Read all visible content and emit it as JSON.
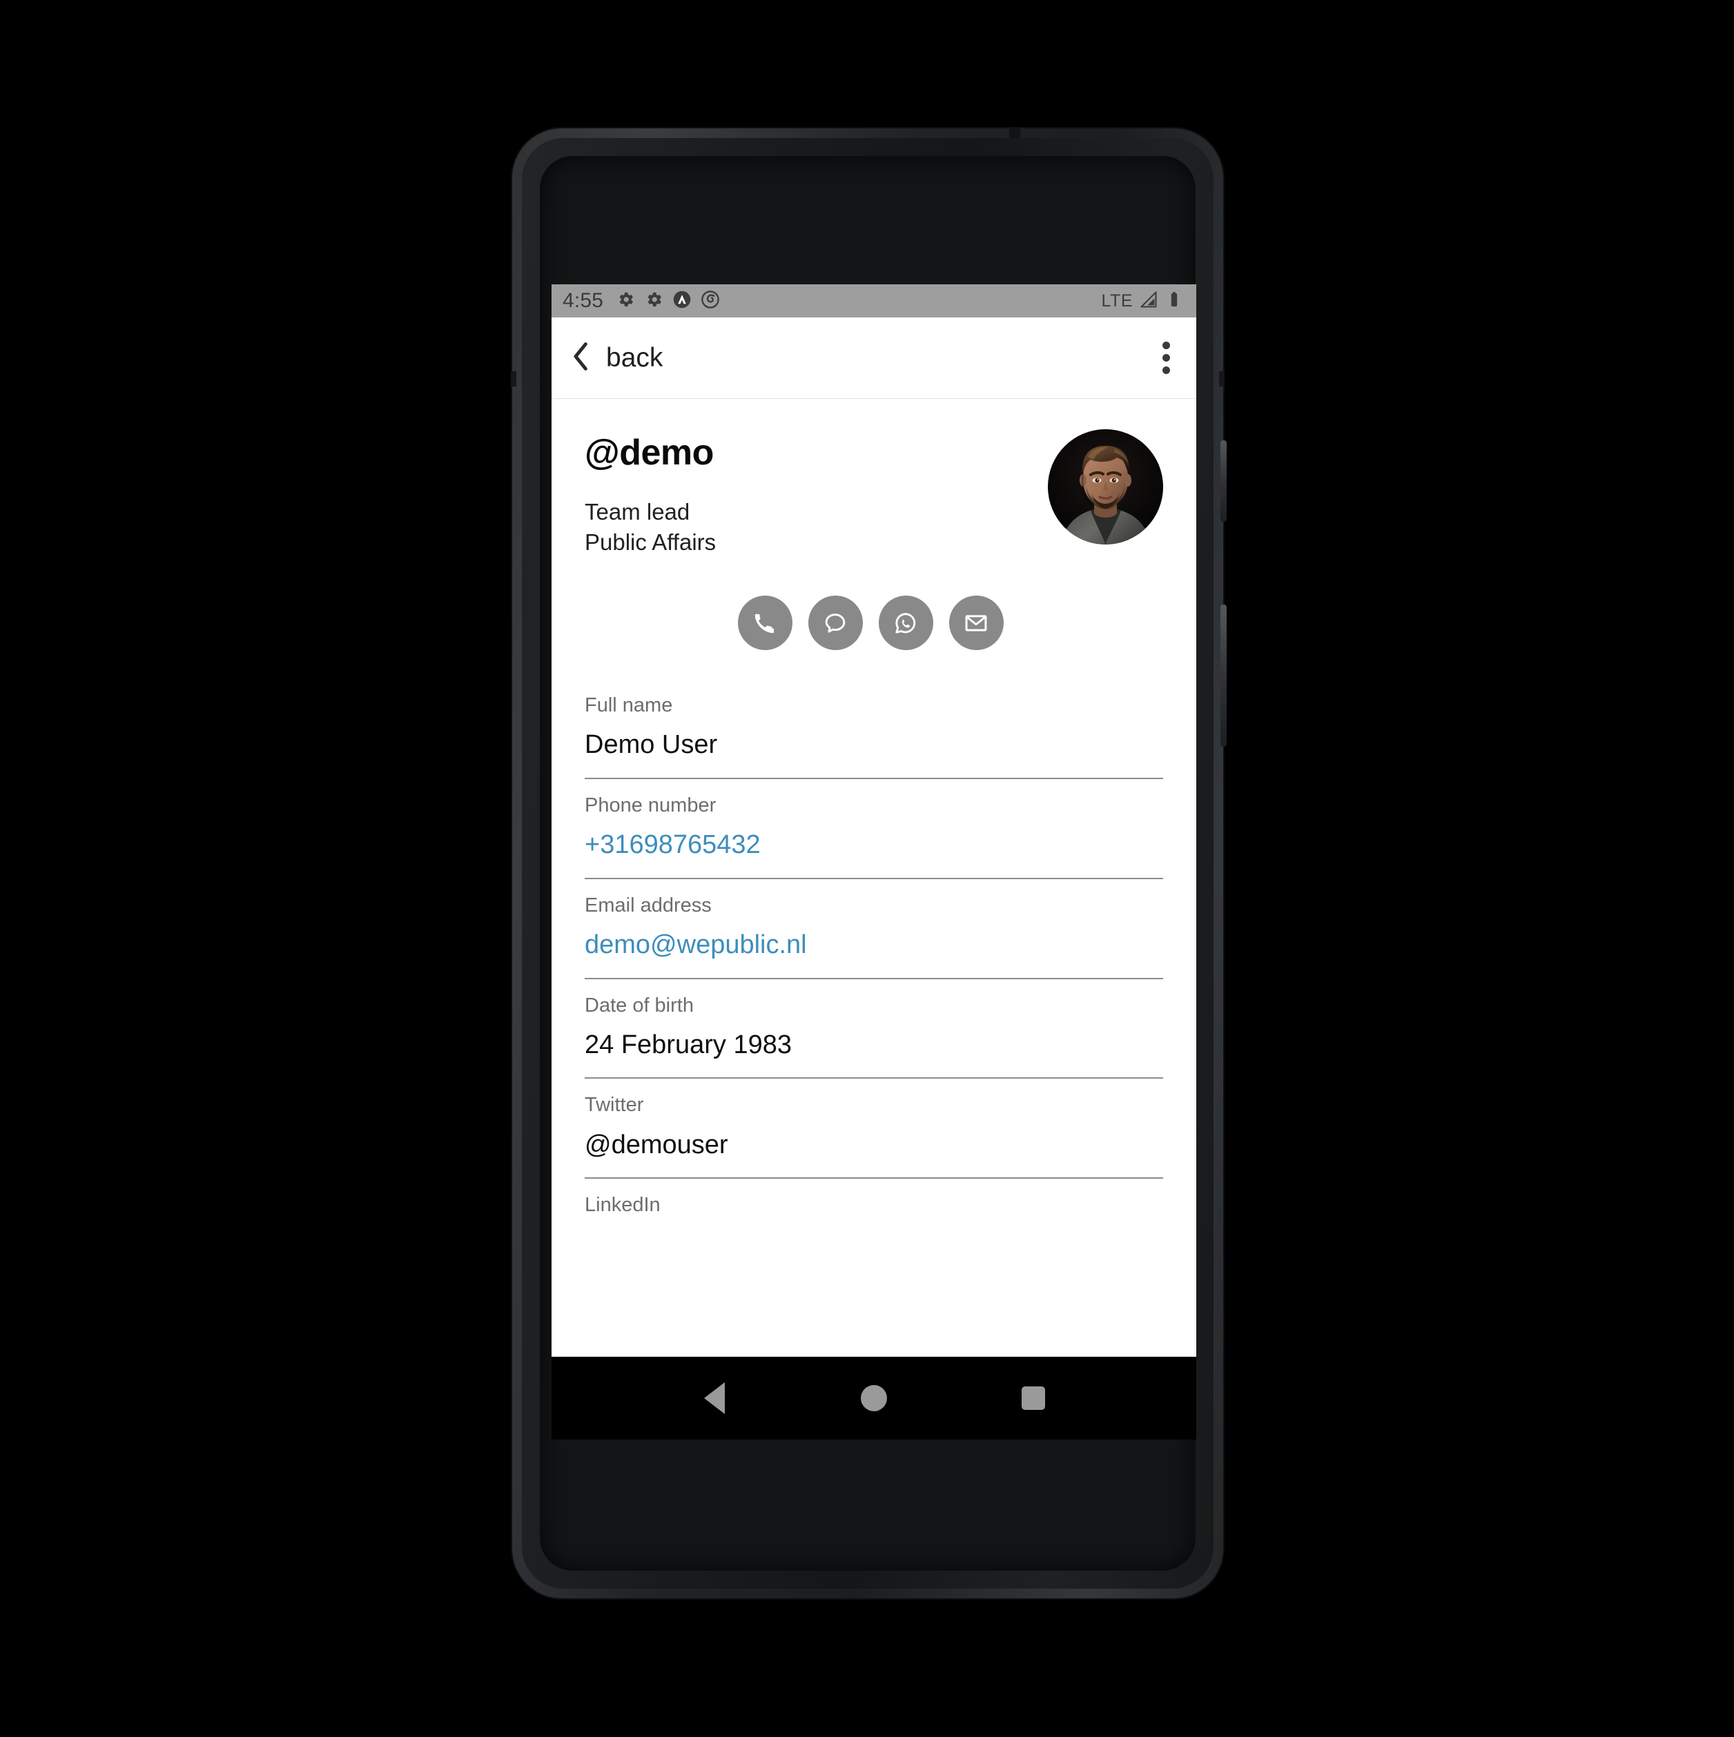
{
  "status_bar": {
    "time": "4:55",
    "left_icons": [
      "gear-icon",
      "gear-icon",
      "caret-circle-icon",
      "spiral-circle-icon"
    ],
    "network_label": "LTE",
    "right_icons": [
      "signal-icon",
      "battery-icon"
    ],
    "background_color": "#9e9e9e"
  },
  "app_bar": {
    "back_label": "back",
    "back_icon": "chevron-left-icon",
    "overflow_icon": "overflow-menu-icon"
  },
  "profile": {
    "handle": "@demo",
    "role_line_1": "Team lead",
    "role_line_2": "Public Affairs",
    "avatar_alt": "profile-photo"
  },
  "actions": [
    {
      "name": "call-button",
      "icon": "phone-icon",
      "color": "#898989"
    },
    {
      "name": "message-button",
      "icon": "chat-bubble-icon",
      "color": "#898989"
    },
    {
      "name": "whatsapp-button",
      "icon": "whatsapp-icon",
      "color": "#898989"
    },
    {
      "name": "email-button",
      "icon": "envelope-icon",
      "color": "#898989"
    }
  ],
  "fields": [
    {
      "label": "Full name",
      "value": "Demo User",
      "is_link": false
    },
    {
      "label": "Phone number",
      "value": "+31698765432",
      "is_link": true
    },
    {
      "label": "Email address",
      "value": "demo@wepublic.nl",
      "is_link": true
    },
    {
      "label": "Date of birth",
      "value": "24 February 1983",
      "is_link": false
    },
    {
      "label": "Twitter",
      "value": "@demouser",
      "is_link": false
    },
    {
      "label": "LinkedIn",
      "value": "",
      "is_link": false
    }
  ],
  "nav_bar": {
    "back": "nav-back-button",
    "home": "nav-home-button",
    "recents": "nav-recents-button"
  },
  "theme": {
    "link_color": "#3d8dbd",
    "label_color": "#6d6d6d",
    "value_color": "#0f0f0f",
    "action_circle_color": "#898989",
    "divider_color": "#8c8c8c"
  }
}
